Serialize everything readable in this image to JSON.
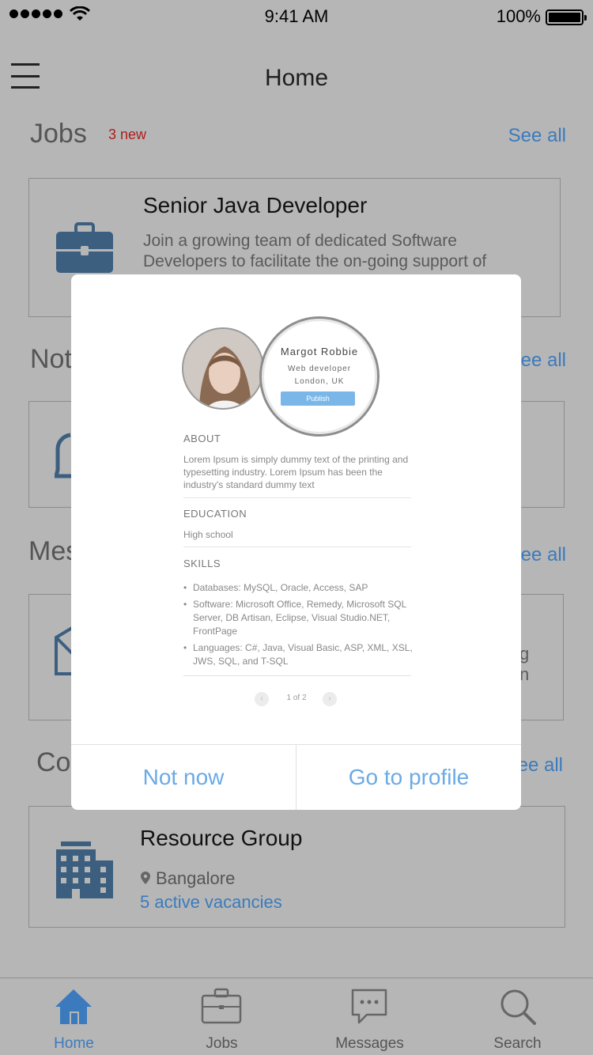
{
  "status": {
    "time": "9:41 AM",
    "battery": "100%"
  },
  "nav": {
    "title": "Home"
  },
  "jobs": {
    "title": "Jobs",
    "badge": "3 new",
    "see_all": "See all",
    "card": {
      "title": "Senior Java Developer",
      "desc_line1": "Join a growing team of dedicated Software",
      "desc_line2": "Developers to facilitate the on-going support of"
    }
  },
  "notifications": {
    "title_partial": "Not",
    "see_all": "See all"
  },
  "messages": {
    "title_partial": "Mes",
    "see_all": "See all",
    "card_tail1": "g",
    "card_tail2": "n"
  },
  "companies": {
    "title_partial": "Co",
    "see_all": "See all",
    "card": {
      "title": "Resource Group",
      "location": "Bangalore",
      "vacancies": "5 active vacancies"
    }
  },
  "tabs": [
    {
      "label": "Home",
      "icon": "home-icon",
      "active": true
    },
    {
      "label": "Jobs",
      "icon": "briefcase-icon",
      "active": false
    },
    {
      "label": "Messages",
      "icon": "chat-icon",
      "active": false
    },
    {
      "label": "Search",
      "icon": "search-icon",
      "active": false
    }
  ],
  "modal": {
    "profile": {
      "name": "Margot Robbie",
      "role": "Web developer",
      "location": "London, UK",
      "publish": "Publish"
    },
    "about": {
      "heading": "ABOUT",
      "text": "Lorem Ipsum is simply dummy text of the printing and typesetting industry. Lorem Ipsum has been the industry's standard dummy text"
    },
    "education": {
      "heading": "EDUCATION",
      "text": "High school"
    },
    "skills": {
      "heading": "SKILLS",
      "items": [
        "Databases: MySQL, Oracle, Access, SAP",
        "Software: Microsoft Office, Remedy, Microsoft SQL Server, DB Artisan, Eclipse, Visual Studio.NET, FrontPage",
        "Languages: C#, Java, Visual Basic, ASP, XML, XSL, JWS, SQL, and T-SQL"
      ]
    },
    "pager": "1 of 2",
    "not_now": "Not now",
    "go_profile": "Go to profile"
  },
  "colors": {
    "accent": "#3b7bbd",
    "modal_button": "#6aaae6",
    "badge": "#b01d1d",
    "overlay_bg": "#b6b6b6"
  }
}
